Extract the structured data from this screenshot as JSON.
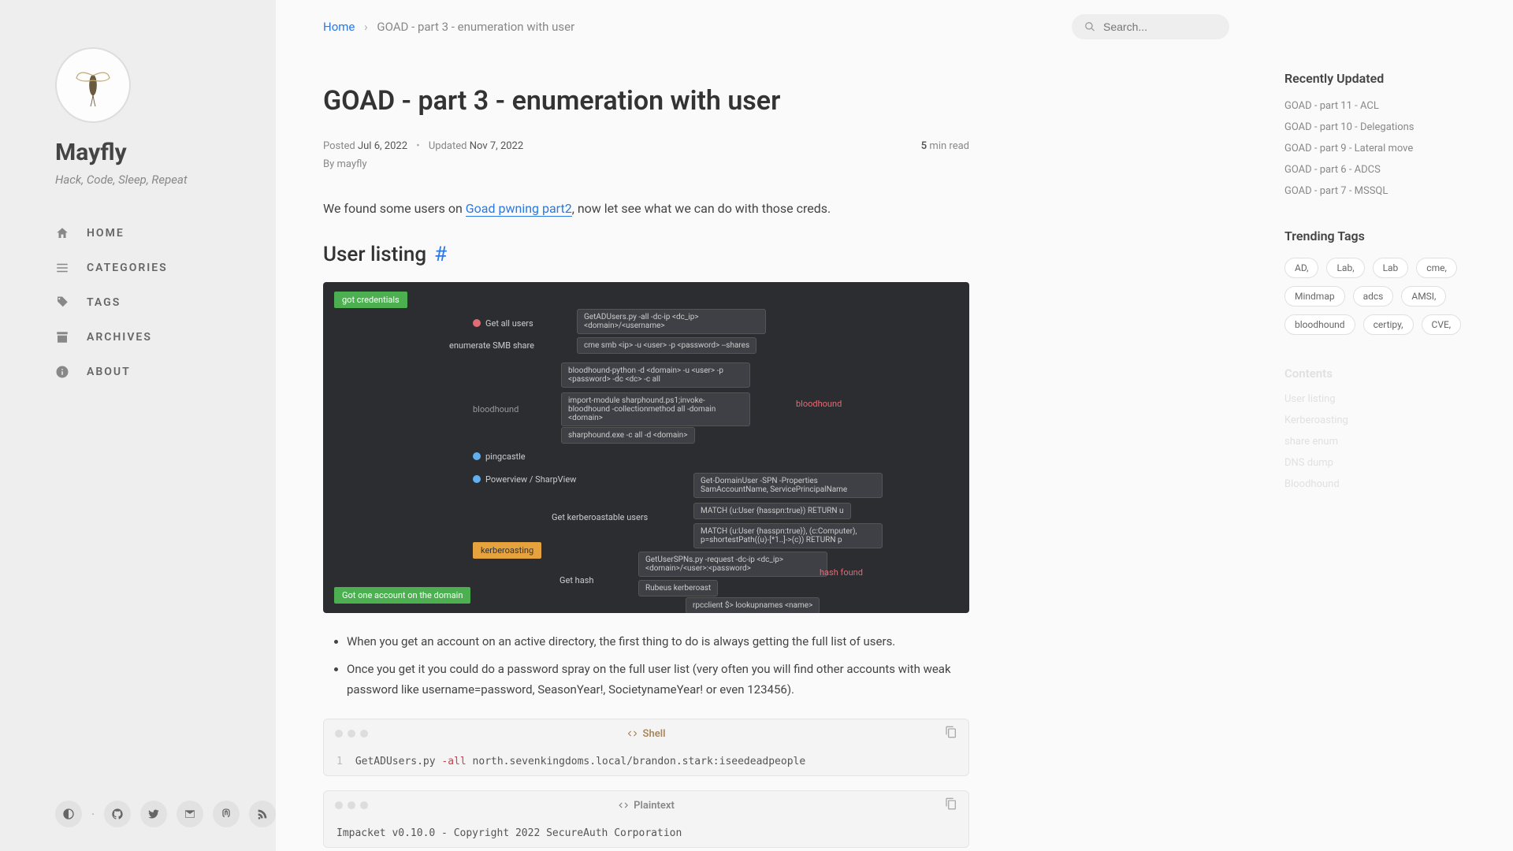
{
  "site": {
    "title": "Mayfly",
    "subtitle": "Hack, Code, Sleep, Repeat"
  },
  "nav": [
    {
      "icon": "home-icon",
      "label": "HOME"
    },
    {
      "icon": "list-icon",
      "label": "CATEGORIES"
    },
    {
      "icon": "tag-icon",
      "label": "TAGS"
    },
    {
      "icon": "archive-icon",
      "label": "ARCHIVES"
    },
    {
      "icon": "info-icon",
      "label": "ABOUT"
    }
  ],
  "breadcrumb": {
    "home": "Home",
    "current": "GOAD - part 3 - enumeration with user"
  },
  "search": {
    "placeholder": "Search..."
  },
  "article": {
    "title": "GOAD - part 3 - enumeration with user",
    "posted_label": "Posted",
    "posted_date": "Jul 6, 2022",
    "updated_label": "Updated",
    "updated_date": "Nov 7, 2022",
    "by_label": "By",
    "author": "mayfly",
    "read_num": "5",
    "read_unit": "min",
    "read_label": "read",
    "intro_pre": "We found some users on ",
    "intro_link": "Goad pwning part2",
    "intro_post": ", now let see what we can do with those creds.",
    "section1": "User listing",
    "bullets": [
      "When you get an account on an active directory, the first thing to do is always getting the full list of users.",
      "Once you get it you could do a password spray on the full user list (very often you will find other accounts with weak password like username=password, SeasonYear!, SocietynameYear! or even 123456)."
    ]
  },
  "mindmap": {
    "badge_top": "got credentials",
    "badge_bottom": "Got one account on the domain",
    "badge_kerb": "kerberoasting",
    "label_bloodhound_branch": "bloodhound",
    "label_pingcastle": "pingcastle",
    "label_powerview": "Powerview / SharpView",
    "label_bloodhound_right": "bloodhound",
    "label_hash_found": "hash found",
    "nodes": {
      "get_all_users": "Get all users",
      "enum_smb": "enumerate SMB share",
      "get_kerb_users": "Get kerberoastable users",
      "get_hash": "Get hash"
    },
    "boxes": {
      "getadusers": "GetADUsers.py -all -dc-ip <dc_ip> <domain>/<username>",
      "cme_smb": "cme smb <ip> -u <user> -p <password> --shares",
      "bh_python": "bloodhound-python -d <domain> -u <user> -p <password> -dc <dc> -c all",
      "sharphound_ps": "import-module sharphound.ps1;invoke-bloodhound -collectionmethod all -domain <domain>",
      "sharphound_exe": "sharphound.exe -c all -d <domain>",
      "get_domainuser": "Get-DomainUser -SPN -Properties SamAccountName, ServicePrincipalName",
      "match1": "MATCH (u:User {hasspn:true}) RETURN u",
      "match2": "MATCH (u:User {hasspn:true}), (c:Computer), p=shortestPath((u)-[*1..]->(c)) RETURN p",
      "getuserspns": "GetUserSPNs.py -request -dc-ip <dc_ip> <domain>/<user>:<password>",
      "rubeus": "Rubeus kerberoast",
      "rpcclient": "rpcclient $> lookupnames <name>"
    }
  },
  "code1": {
    "lang": "Shell",
    "line_no": "1",
    "cmd_pre": "GetADUsers.py ",
    "cmd_flag": "-all",
    "cmd_post": " north.sevenkingdoms.local/brandon.stark:iseedeadpeople"
  },
  "code2": {
    "lang": "Plaintext",
    "line": "Impacket v0.10.0 - Copyright 2022 SecureAuth Corporation"
  },
  "recent": {
    "title": "Recently Updated",
    "items": [
      "GOAD - part 11 - ACL",
      "GOAD - part 10 - Delegations",
      "GOAD - part 9 - Lateral move",
      "GOAD - part 6 - ADCS",
      "GOAD - part 7 - MSSQL"
    ]
  },
  "trending": {
    "title": "Trending Tags",
    "tags": [
      "AD,",
      "Lab,",
      "Lab",
      "cme,",
      "Mindmap",
      "adcs",
      "AMSI,",
      "bloodhound",
      "certipy,",
      "CVE,"
    ]
  },
  "contents": {
    "title": "Contents",
    "items": [
      "User listing",
      "Kerberoasting",
      "share enum",
      "DNS dump",
      "Bloodhound"
    ]
  }
}
